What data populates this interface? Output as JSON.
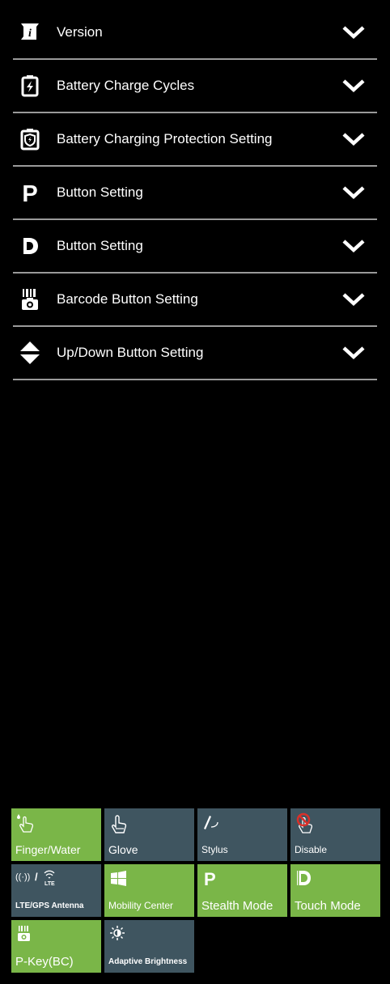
{
  "settings": {
    "items": [
      {
        "label": "Version",
        "icon": "version-info-icon"
      },
      {
        "label": "Battery Charge Cycles",
        "icon": "battery-icon"
      },
      {
        "label": "Battery Charging Protection Setting",
        "icon": "battery-shield-icon"
      },
      {
        "label": "Button Setting",
        "icon": "p-key-icon"
      },
      {
        "label": "Button Setting",
        "icon": "d-key-icon"
      },
      {
        "label": "Barcode Button Setting",
        "icon": "barcode-camera-icon"
      },
      {
        "label": "Up/Down Button Setting",
        "icon": "up-down-arrows-icon"
      }
    ]
  },
  "tiles": [
    {
      "label": "Finger/Water",
      "state": "active",
      "icon": "finger-water-touch-icon"
    },
    {
      "label": "Glove",
      "state": "inactive",
      "icon": "glove-hand-icon"
    },
    {
      "label": "Stylus",
      "state": "inactive",
      "icon": "stylus-icon"
    },
    {
      "label": "Disable",
      "state": "inactive",
      "icon": "touch-disabled-icon"
    },
    {
      "label": "LTE/GPS Antenna",
      "state": "inactive",
      "icon": "antenna-lte-icon"
    },
    {
      "label": "Mobility Center",
      "state": "active",
      "icon": "windows-logo-icon"
    },
    {
      "label": "Stealth Mode",
      "state": "active",
      "icon": "p-key-icon"
    },
    {
      "label": "Touch Mode",
      "state": "active",
      "icon": "d-key-icon"
    },
    {
      "label": "P-Key(BC)",
      "state": "active",
      "icon": "barcode-camera-icon"
    },
    {
      "label": "Adaptive Brightness",
      "state": "inactive",
      "icon": "brightness-sun-icon"
    }
  ],
  "colors": {
    "tile_active": "#7ab648",
    "tile_inactive": "#3f5560",
    "background": "#000000",
    "divider": "#9a9a9a"
  }
}
